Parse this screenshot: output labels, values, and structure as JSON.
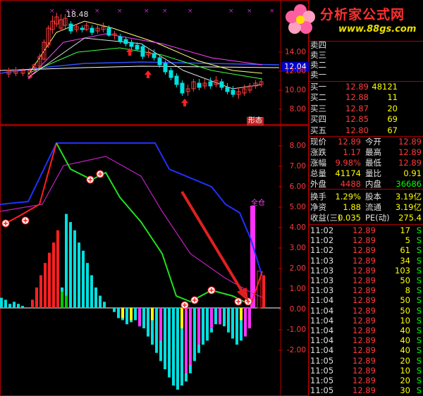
{
  "logo": {
    "name": "分析家公式网",
    "url": "www.88gs.com"
  },
  "price_chart": {
    "peak_label": "18.48",
    "current_price_box": "12.04",
    "badge": "形态",
    "y_ticks": [
      "14.00",
      "12.00",
      "10.00",
      "8.00"
    ]
  },
  "indicator_chart": {
    "y_ticks": [
      "8.00",
      "7.00",
      "6.00",
      "5.00",
      "4.00",
      "3.00",
      "2.00",
      "1.00",
      "0.00",
      "-1.00",
      "-2.00"
    ],
    "signal_label": "全仓"
  },
  "order_book": {
    "asks": [
      {
        "label": "卖四",
        "price": "",
        "vol": ""
      },
      {
        "label": "卖三",
        "price": "",
        "vol": ""
      },
      {
        "label": "卖二",
        "price": "",
        "vol": ""
      },
      {
        "label": "卖一",
        "price": "",
        "vol": ""
      }
    ],
    "bids": [
      {
        "label": "买一",
        "price": "12.89",
        "vol": "48121"
      },
      {
        "label": "买二",
        "price": "12.88",
        "vol": "11"
      },
      {
        "label": "买三",
        "price": "12.87",
        "vol": "20"
      },
      {
        "label": "买四",
        "price": "12.85",
        "vol": "69"
      },
      {
        "label": "买五",
        "price": "12.80",
        "vol": "67"
      }
    ]
  },
  "quote": {
    "rows": [
      {
        "l1": "现价",
        "v1": "12.89",
        "l2": "今开",
        "v2": "12.89"
      },
      {
        "l1": "涨跌",
        "v1": "1.17",
        "l2": "最高",
        "v2": "12.89"
      },
      {
        "l1": "涨幅",
        "v1": "9.98%",
        "l2": "最低",
        "v2": "12.89"
      },
      {
        "l1": "总量",
        "v1": "41174",
        "l2": "量比",
        "v2": "0.91"
      },
      {
        "l1": "外盘",
        "v1": "4488",
        "l2": "内盘",
        "v2": "36686"
      }
    ]
  },
  "stats": {
    "rows": [
      {
        "l1": "换手",
        "v1": "1.29%",
        "l2": "股本",
        "v2": "3.19亿"
      },
      {
        "l1": "净资",
        "v1": "1.88",
        "l2": "流通",
        "v2": "3.19亿"
      },
      {
        "l1": "收益(三)",
        "v1": "0.035",
        "l2": "PE(动)",
        "v2": "275.4"
      }
    ]
  },
  "ticks": [
    {
      "time": "11:02",
      "price": "12.89",
      "vol": "17",
      "side": "S"
    },
    {
      "time": "11:02",
      "price": "12.89",
      "vol": "5",
      "side": "S"
    },
    {
      "time": "11:02",
      "price": "12.89",
      "vol": "61",
      "side": "S"
    },
    {
      "time": "11:03",
      "price": "12.89",
      "vol": "34",
      "side": "S"
    },
    {
      "time": "11:03",
      "price": "12.89",
      "vol": "103",
      "side": "S"
    },
    {
      "time": "11:03",
      "price": "12.89",
      "vol": "50",
      "side": "S"
    },
    {
      "time": "11:03",
      "price": "12.89",
      "vol": "8",
      "side": "S"
    },
    {
      "time": "11:04",
      "price": "12.89",
      "vol": "50",
      "side": "S"
    },
    {
      "time": "11:04",
      "price": "12.89",
      "vol": "50",
      "side": "S"
    },
    {
      "time": "11:04",
      "price": "12.89",
      "vol": "10",
      "side": "S"
    },
    {
      "time": "11:04",
      "price": "12.89",
      "vol": "40",
      "side": "S"
    },
    {
      "time": "11:04",
      "price": "12.89",
      "vol": "40",
      "side": "S"
    },
    {
      "time": "11:04",
      "price": "12.89",
      "vol": "40",
      "side": "S"
    },
    {
      "time": "11:05",
      "price": "12.89",
      "vol": "20",
      "side": "S"
    },
    {
      "time": "11:05",
      "price": "12.89",
      "vol": "10",
      "side": "S"
    },
    {
      "time": "11:05",
      "price": "12.89",
      "vol": "20",
      "side": "S"
    },
    {
      "time": "11:05",
      "price": "12.89",
      "vol": "30",
      "side": "S"
    }
  ],
  "colors": {
    "up": "#ff3b3b",
    "down": "#00e0e0",
    "frame": "#b00000"
  }
}
